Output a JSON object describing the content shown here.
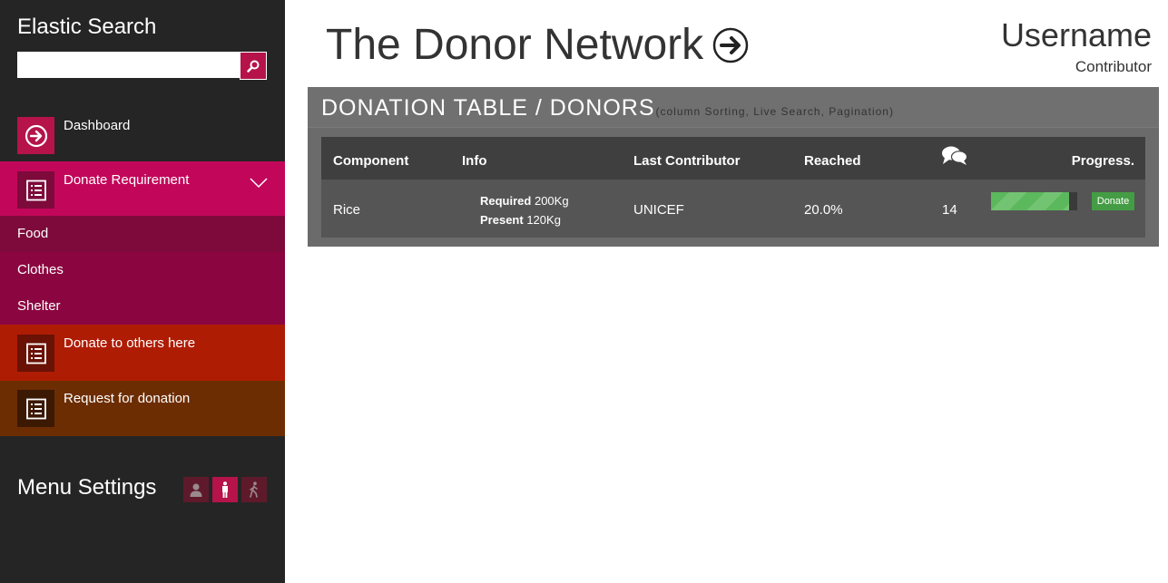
{
  "sidebar": {
    "brand": "Elastic Search",
    "search": {
      "value": "",
      "placeholder": ""
    },
    "items": [
      {
        "label": "Dashboard",
        "icon": "arrow-circle-right-icon",
        "color": "#252525",
        "icon_bg": "#b5134a"
      },
      {
        "label": "Donate Requirement",
        "icon": "list-icon",
        "color": "#c2075a",
        "icon_bg": "#7d0a3b",
        "expanded": true,
        "children": [
          "Food",
          "Clothes",
          "Shelter"
        ]
      },
      {
        "label": "Donate to others here",
        "icon": "list-icon",
        "color": "#ae1c04",
        "icon_bg": "#6a1205"
      },
      {
        "label": "Request for donation",
        "icon": "list-icon",
        "color": "#6d2d03",
        "icon_bg": "#3b1903"
      }
    ],
    "menu_settings": {
      "label": "Menu Settings",
      "buttons": [
        "user-icon",
        "standing-person-icon",
        "walking-person-icon"
      ],
      "active_index": 1
    }
  },
  "header": {
    "title": "The Donor Network",
    "username": "Username",
    "role": "Contributor"
  },
  "panel": {
    "title": "DONATION TABLE / DONORS",
    "subtitle": "(column Sorting, Live Search, Pagination)",
    "columns": [
      "Component",
      "Info",
      "Last Contributor",
      "Reached",
      "comments-icon",
      "Progress."
    ],
    "rows": [
      {
        "component": "Rice",
        "required_label": "Required",
        "required_value": "200Kg",
        "present_label": "Present",
        "present_value": "120Kg",
        "last_contributor": "UNICEF",
        "reached": "20.0%",
        "comments": "14",
        "progress": 0.9,
        "action": "Donate"
      }
    ]
  },
  "colors": {
    "sidebar_bg": "#252525",
    "accent": "#b5134a",
    "submenu_food": "#7d0a3b",
    "submenu": "#8b0540",
    "panel_bg": "#6b6b6b",
    "progress_green": "#5cb85c"
  }
}
